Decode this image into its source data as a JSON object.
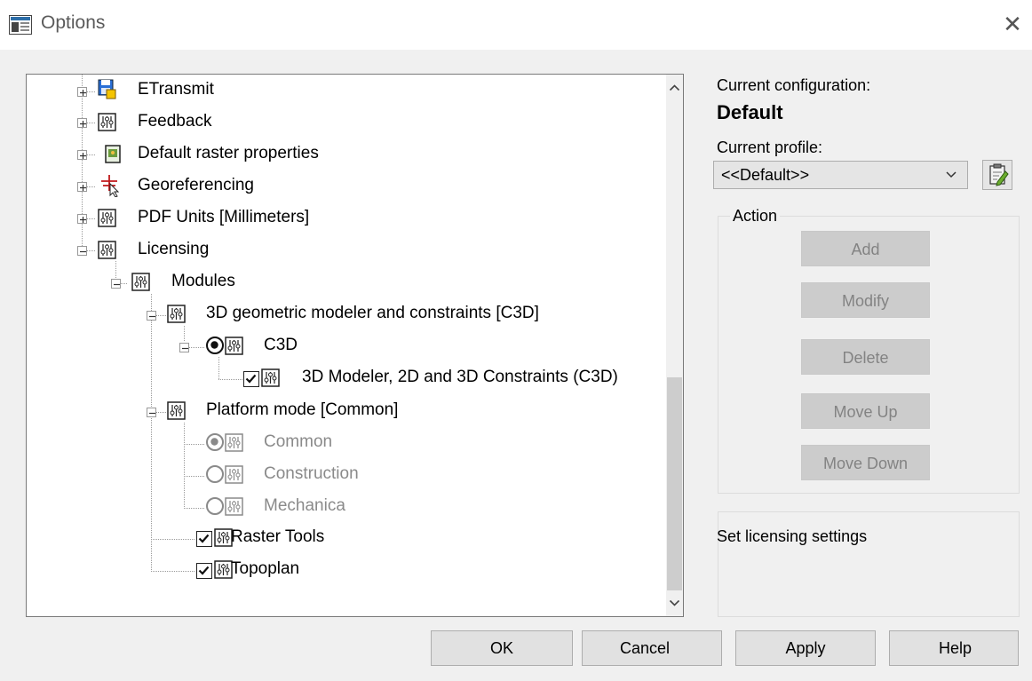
{
  "window": {
    "title": "Options"
  },
  "tree": {
    "items": [
      {
        "label": "ETransmit"
      },
      {
        "label": "Feedback"
      },
      {
        "label": "Default raster properties"
      },
      {
        "label": "Georeferencing"
      },
      {
        "label": "PDF Units [Millimeters]"
      },
      {
        "label": "Licensing"
      },
      {
        "label": "Modules"
      },
      {
        "label": "3D geometric modeler and constraints [C3D]"
      },
      {
        "label": "C3D"
      },
      {
        "label": "3D Modeler, 2D and 3D Constraints (C3D)"
      },
      {
        "label": "Platform mode [Common]"
      },
      {
        "label": "Common"
      },
      {
        "label": "Construction"
      },
      {
        "label": "Mechanica"
      },
      {
        "label": "Raster Tools"
      },
      {
        "label": "Topoplan"
      }
    ]
  },
  "config": {
    "current_configuration_label": "Current configuration:",
    "current_configuration_value": "Default",
    "current_profile_label": "Current profile:",
    "current_profile_value": "<<Default>>"
  },
  "action": {
    "legend": "Action",
    "buttons": [
      "Add",
      "Modify",
      "Delete",
      "Move Up",
      "Move Down"
    ]
  },
  "description": "Set licensing settings",
  "footer": {
    "ok": "OK",
    "cancel": "Cancel",
    "apply": "Apply",
    "help": "Help"
  }
}
